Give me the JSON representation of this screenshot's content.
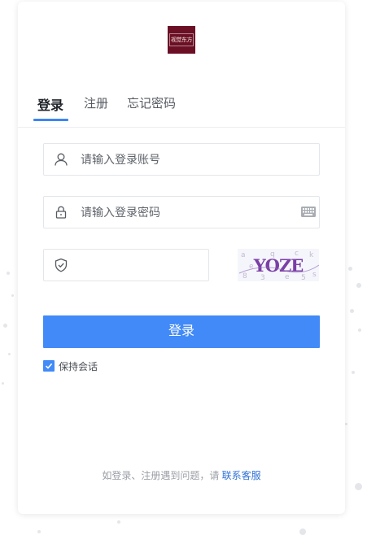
{
  "logo": {
    "text": "视觉东方",
    "brand_color": "#6b0f25"
  },
  "tabs": [
    {
      "label": "登录",
      "active": true
    },
    {
      "label": "注册",
      "active": false
    },
    {
      "label": "忘记密码",
      "active": false
    }
  ],
  "form": {
    "account": {
      "placeholder": "请输入登录账号",
      "value": "",
      "icon": "user-icon"
    },
    "password": {
      "placeholder": "请输入登录密码",
      "value": "",
      "icon": "lock-icon",
      "trailing_icon": "keyboard-icon"
    },
    "captcha": {
      "placeholder": "",
      "value": "",
      "icon": "shield-check-icon",
      "captcha_text": "YOZE"
    }
  },
  "login_button": {
    "label": "登录"
  },
  "remember": {
    "label": "保持会话",
    "checked": true
  },
  "footer": {
    "text": "如登录、注册遇到问题，请",
    "link_label": "联系客服"
  },
  "colors": {
    "accent": "#418af7",
    "link": "#2f72d6",
    "captcha_text": "#7b3fa6"
  }
}
